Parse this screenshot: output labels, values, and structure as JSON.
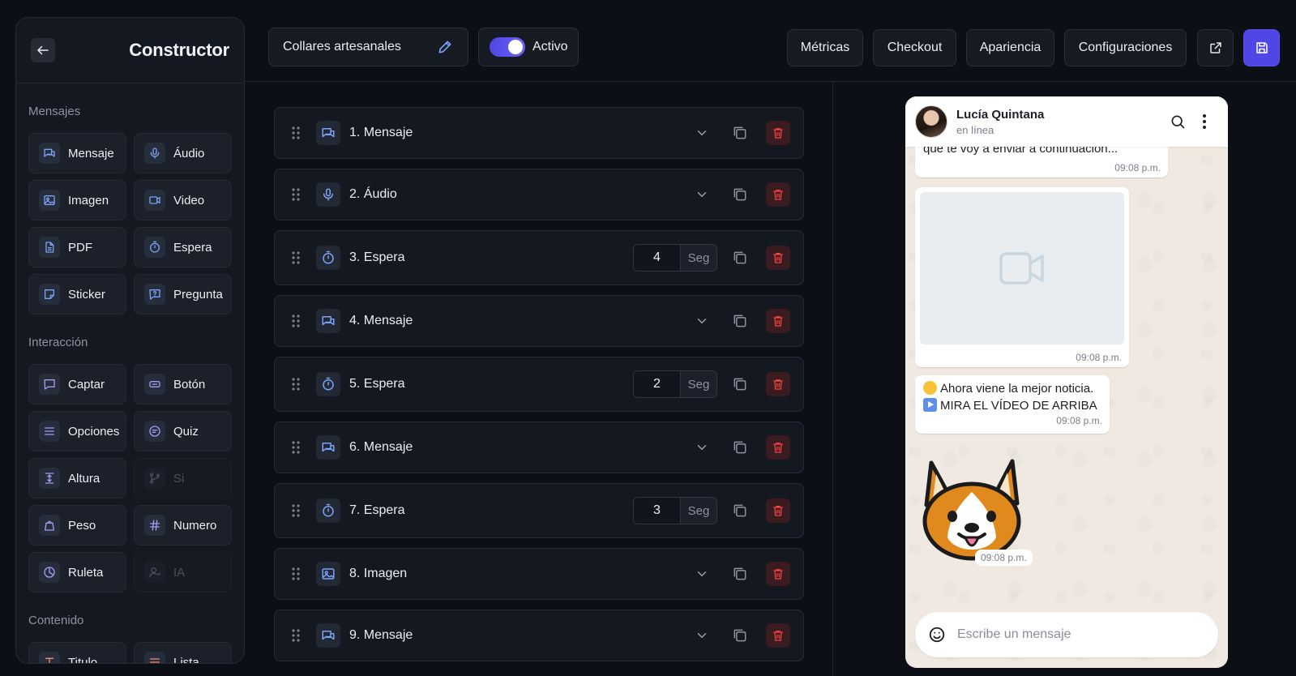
{
  "sidebar": {
    "title": "Constructor",
    "sections": [
      {
        "title": "Mensajes",
        "items": [
          {
            "label": "Mensaje",
            "icon": "message-icon",
            "enabled": true
          },
          {
            "label": "Áudio",
            "icon": "microphone-icon",
            "enabled": true
          },
          {
            "label": "Imagen",
            "icon": "image-icon",
            "enabled": true
          },
          {
            "label": "Video",
            "icon": "video-icon",
            "enabled": true
          },
          {
            "label": "PDF",
            "icon": "document-icon",
            "enabled": true
          },
          {
            "label": "Espera",
            "icon": "timer-icon",
            "enabled": true
          },
          {
            "label": "Sticker",
            "icon": "sticker-icon",
            "enabled": true
          },
          {
            "label": "Pregunta",
            "icon": "question-icon",
            "enabled": true
          }
        ]
      },
      {
        "title": "Interacción",
        "items": [
          {
            "label": "Captar",
            "icon": "capture-icon",
            "enabled": true
          },
          {
            "label": "Botón",
            "icon": "button-icon",
            "enabled": true
          },
          {
            "label": "Opciones",
            "icon": "options-icon",
            "enabled": true
          },
          {
            "label": "Quiz",
            "icon": "quiz-icon",
            "enabled": true
          },
          {
            "label": "Altura",
            "icon": "height-icon",
            "enabled": true
          },
          {
            "label": "Si",
            "icon": "branch-icon",
            "enabled": false
          },
          {
            "label": "Peso",
            "icon": "weight-icon",
            "enabled": true
          },
          {
            "label": "Numero",
            "icon": "hash-icon",
            "enabled": true
          },
          {
            "label": "Ruleta",
            "icon": "roulette-icon",
            "enabled": true
          },
          {
            "label": "IA",
            "icon": "ai-user-icon",
            "enabled": false
          }
        ]
      },
      {
        "title": "Contenido",
        "items": [
          {
            "label": "Titulo",
            "icon": "title-icon",
            "enabled": true
          },
          {
            "label": "Lista",
            "icon": "list-icon",
            "enabled": true
          }
        ]
      }
    ]
  },
  "topbar": {
    "flow_name": "Collares artesanales",
    "active_label": "Activo",
    "active": true,
    "nav": [
      "Métricas",
      "Checkout",
      "Apariencia",
      "Configuraciones"
    ]
  },
  "steps": [
    {
      "label": "1. Mensaje",
      "type": "message"
    },
    {
      "label": "2. Áudio",
      "type": "audio"
    },
    {
      "label": "3. Espera",
      "type": "wait",
      "value": "4",
      "unit": "Seg"
    },
    {
      "label": "4. Mensaje",
      "type": "message"
    },
    {
      "label": "5. Espera",
      "type": "wait",
      "value": "2",
      "unit": "Seg"
    },
    {
      "label": "6. Mensaje",
      "type": "message"
    },
    {
      "label": "7. Espera",
      "type": "wait",
      "value": "3",
      "unit": "Seg"
    },
    {
      "label": "8. Imagen",
      "type": "image"
    },
    {
      "label": "9. Mensaje",
      "type": "message"
    }
  ],
  "preview": {
    "contact_name": "Lucía Quintana",
    "contact_status": "en línea",
    "messages": [
      {
        "text": "que te voy a enviar a continuación...",
        "time": "09:08 p.m."
      },
      {
        "type": "video",
        "time": "09:08 p.m."
      },
      {
        "line1": "Ahora viene la mejor noticia.",
        "line2": "MIRA EL VÍDEO DE ARRIBA",
        "time": "09:08 p.m."
      },
      {
        "type": "sticker",
        "time": "09:08 p.m."
      }
    ],
    "composer_placeholder": "Escribe un mensaje"
  },
  "colors": {
    "accent": "#4f46e5",
    "background": "#0c0f16",
    "panel": "#141821",
    "delete": "#ef4444",
    "icon_blue": "#7aa2f7"
  }
}
